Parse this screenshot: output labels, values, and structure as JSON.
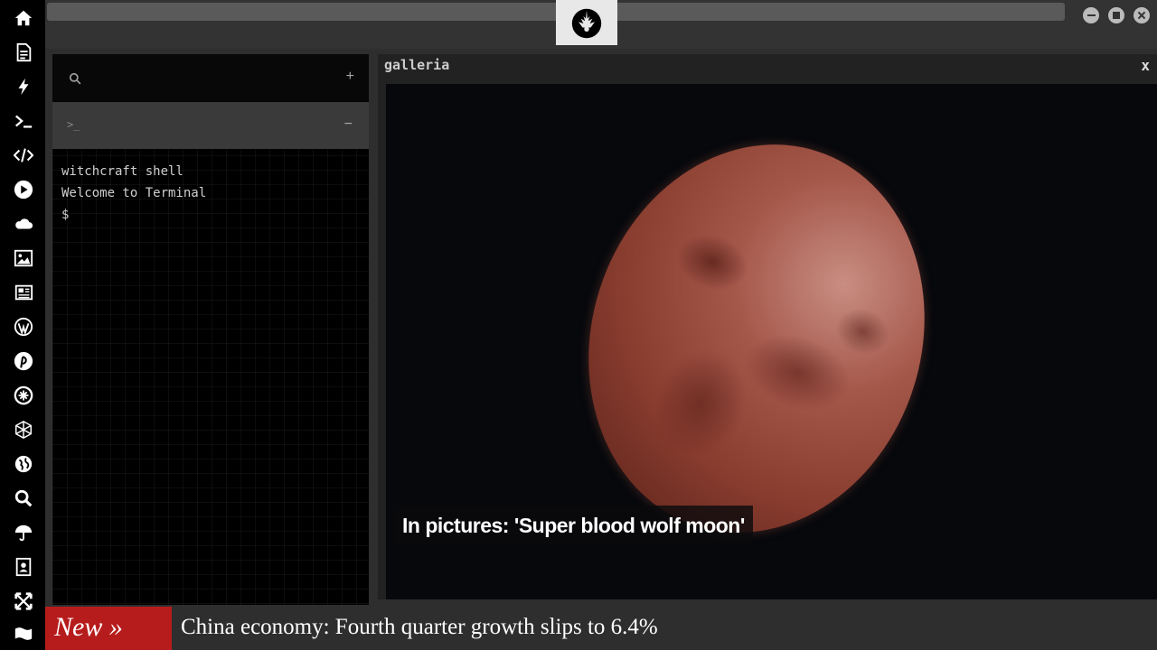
{
  "sidebar": {
    "icons": [
      "home-icon",
      "document-icon",
      "bolt-icon",
      "terminal-icon",
      "code-icon",
      "play-icon",
      "cloud-icon",
      "image-icon",
      "newspaper-icon",
      "wordpress-icon",
      "pinterest-icon",
      "settings-wheel-icon",
      "mesh-icon",
      "globe-icon",
      "search-icon",
      "umbrella-icon",
      "contact-book-icon",
      "expand-icon",
      "flag-icon"
    ]
  },
  "terminal": {
    "search_icon": "search-icon",
    "add_label": "+",
    "tab_prompt": ">_",
    "minimize_label": "−",
    "lines": [
      "witchcraft shell",
      "Welcome to Terminal",
      "$"
    ]
  },
  "gallery": {
    "title": "galleria",
    "close_label": "x",
    "caption": "In pictures: 'Super blood wolf moon'"
  },
  "ticker": {
    "label": "New »",
    "headline": "China economy: Fourth quarter growth slips to 6.4%"
  },
  "colors": {
    "accent_red": "#b71c1c",
    "background": "#2e2e2e",
    "sidebar": "#000000"
  }
}
